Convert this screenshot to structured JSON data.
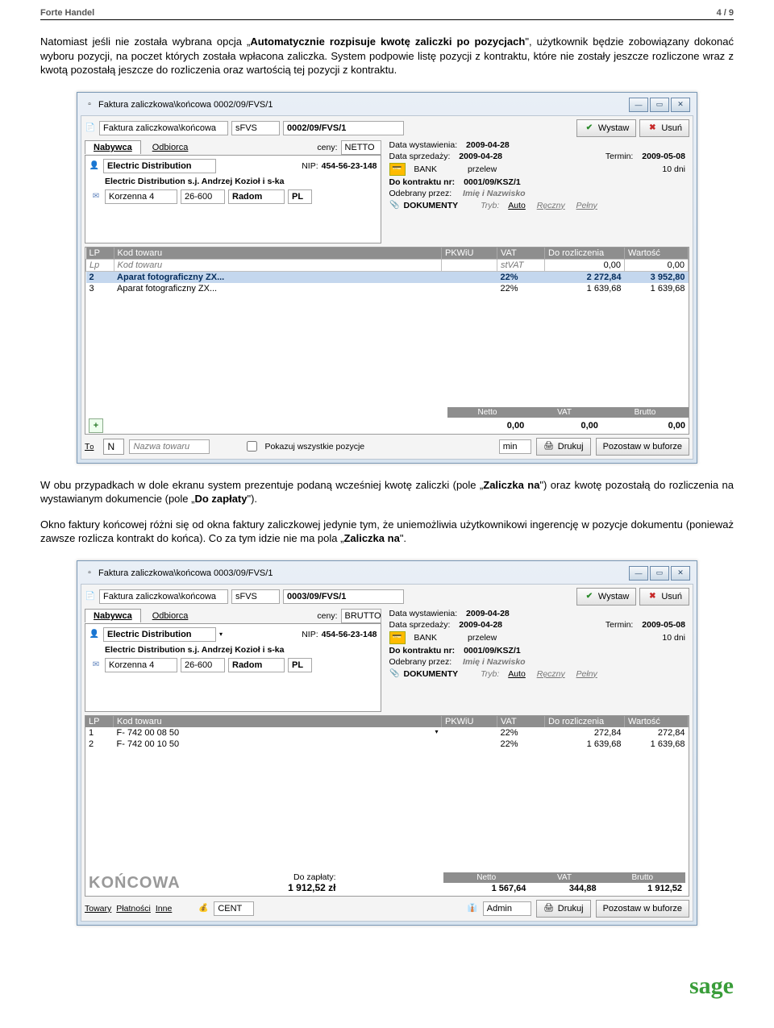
{
  "doc": {
    "title": "Forte Handel",
    "page": "4 / 9"
  },
  "para1a": "Natomiast jeśli nie została wybrana opcja „",
  "para1b": "Automatycznie rozpisuje kwotę zaliczki po pozycjach",
  "para1c": "\", użytkownik będzie zobowiązany dokonać wyboru pozycji, na poczet których została wpłacona zaliczka. System podpowie listę pozycji z kontraktu, które nie zostały jeszcze rozliczone wraz z kwotą pozostałą jeszcze do rozliczenia oraz wartością tej pozycji z kontraktu.",
  "para2a": "W obu przypadkach w dole ekranu system prezentuje podaną wcześniej kwotę zaliczki (pole „",
  "para2b": "Zaliczka na",
  "para2c": "\") oraz kwotę pozostałą do rozliczenia na wystawianym dokumencie (pole „",
  "para2d": "Do zapłaty",
  "para2e": "\").",
  "para3a": "Okno faktury końcowej różni się od okna faktury zaliczkowej jedynie tym, że uniemożliwia użytkownikowi ingerencję w pozycje dokumentu (ponieważ zawsze rozlicza kontrakt do końca). Co za tym idzie nie ma pola „",
  "para3b": "Zaliczka na",
  "para3c": "\".",
  "win1": {
    "title": "Faktura zaliczkowa\\końcowa 0002/09/FVS/1",
    "type_v": "Faktura zaliczkowa\\końcowa",
    "series": "sFVS",
    "number": "0002/09/FVS/1",
    "wystaw": "Wystaw",
    "usun": "Usuń",
    "tab_nabywca": "Nabywca",
    "tab_odbiorca": "Odbiorca",
    "ceny_l": "ceny:",
    "ceny_v": "NETTO",
    "data_wys_l": "Data wystawienia:",
    "data_wys_v": "2009-04-28",
    "data_spr_l": "Data sprzedaży:",
    "data_spr_v": "2009-04-28",
    "termin_l": "Termin:",
    "termin_v": "2009-05-08",
    "nip_l": "NIP:",
    "nip_v": "454-56-23-148",
    "firma": "Electric Distribution",
    "firma_full": "Electric Distribution s.j. Andrzej Kozioł i s-ka",
    "adr1": "Korzenna 4",
    "adr2": "26-600",
    "adr3": "Radom",
    "adr4": "PL",
    "bank_l": "BANK",
    "bank_v": "przelew",
    "dni": "10 dni",
    "kontr_l": "Do kontraktu nr:",
    "kontr_v": "0001/09/KSZ/1",
    "odebr_l": "Odebrany przez:",
    "odebr_v": "Imię i Nazwisko",
    "doks": "DOKUMENTY",
    "tryb_l": "Tryb:",
    "tryb_auto": "Auto",
    "tryb_reczny": "Ręczny",
    "tryb_pelny": "Pełny",
    "col_lp": "LP",
    "col_kod": "Kod towaru",
    "col_pkwiu": "PKWiU",
    "col_vat": "VAT",
    "col_roz": "Do rozliczenia",
    "col_wart": "Wartość",
    "inp_lp": "Lp",
    "inp_kod": "Kod towaru",
    "inp_sv": "stVAT",
    "inp_zero": "0,00",
    "row2_lp": "2",
    "row2_kod": "Aparat fotograficzny ZX...",
    "row2_vat": "22%",
    "row2_roz": "2 272,84",
    "row2_wart": "3 952,80",
    "row3_lp": "3",
    "row3_kod": "Aparat fotograficzny ZX...",
    "row3_vat": "22%",
    "row3_roz": "1 639,68",
    "row3_wart": "1 639,68",
    "tot_netto_l": "Netto",
    "tot_vat_l": "VAT",
    "tot_brutto_l": "Brutto",
    "tot_v": "0,00",
    "foot_t": "Towary",
    "foot_n": "N",
    "foot_nazwa": "Nazwa towaru",
    "foot_chk": "Pokazuj wszystkie pozycje",
    "foot_min": "min",
    "foot_drukuj": "Drukuj",
    "foot_pozostaw": "Pozostaw w buforze"
  },
  "win2": {
    "title": "Faktura zaliczkowa\\końcowa 0003/09/FVS/1",
    "type_v": "Faktura zaliczkowa\\końcowa",
    "series": "sFVS",
    "number": "0003/09/FVS/1",
    "wystaw": "Wystaw",
    "usun": "Usuń",
    "tab_nabywca": "Nabywca",
    "tab_odbiorca": "Odbiorca",
    "ceny_l": "ceny:",
    "ceny_v": "BRUTTO",
    "data_wys_l": "Data wystawienia:",
    "data_wys_v": "2009-04-28",
    "data_spr_l": "Data sprzedaży:",
    "data_spr_v": "2009-04-28",
    "termin_l": "Termin:",
    "termin_v": "2009-05-08",
    "nip_l": "NIP:",
    "nip_v": "454-56-23-148",
    "firma": "Electric Distribution",
    "firma_full": "Electric Distribution s.j. Andrzej Kozioł i s-ka",
    "adr1": "Korzenna 4",
    "adr2": "26-600",
    "adr3": "Radom",
    "adr4": "PL",
    "bank_l": "BANK",
    "bank_v": "przelew",
    "dni": "10 dni",
    "kontr_l": "Do kontraktu nr:",
    "kontr_v": "0001/09/KSZ/1",
    "odebr_l": "Odebrany przez:",
    "odebr_v": "Imię i Nazwisko",
    "doks": "DOKUMENTY",
    "tryb_l": "Tryb:",
    "tryb_auto": "Auto",
    "tryb_reczny": "Ręczny",
    "tryb_pelny": "Pełny",
    "col_lp": "LP",
    "col_kod": "Kod towaru",
    "col_pkwiu": "PKWiU",
    "col_vat": "VAT",
    "col_roz": "Do rozliczenia",
    "col_wart": "Wartość",
    "row1_lp": "1",
    "row1_kod": "F- 742 00 08 50",
    "row1_vat": "22%",
    "row1_roz": "272,84",
    "row1_wart": "272,84",
    "row2_lp": "2",
    "row2_kod": "F- 742 00 10 50",
    "row2_vat": "22%",
    "row2_roz": "1 639,68",
    "row2_wart": "1 639,68",
    "koncowa": "KOŃCOWA",
    "dozap_l": "Do zapłaty:",
    "dozap_v": "1 912,52  zł",
    "tot_netto_l": "Netto",
    "tot_vat_l": "VAT",
    "tot_brutto_l": "Brutto",
    "tot_netto": "1 567,64",
    "tot_vat": "344,88",
    "tot_brutto": "1 912,52",
    "foot_towary": "Towary",
    "foot_platnosci": "Płatności",
    "foot_inne": "Inne",
    "foot_cent": "CENT",
    "foot_admin": "Admin",
    "foot_drukuj": "Drukuj",
    "foot_pozostaw": "Pozostaw w buforze"
  },
  "brand": "sage"
}
